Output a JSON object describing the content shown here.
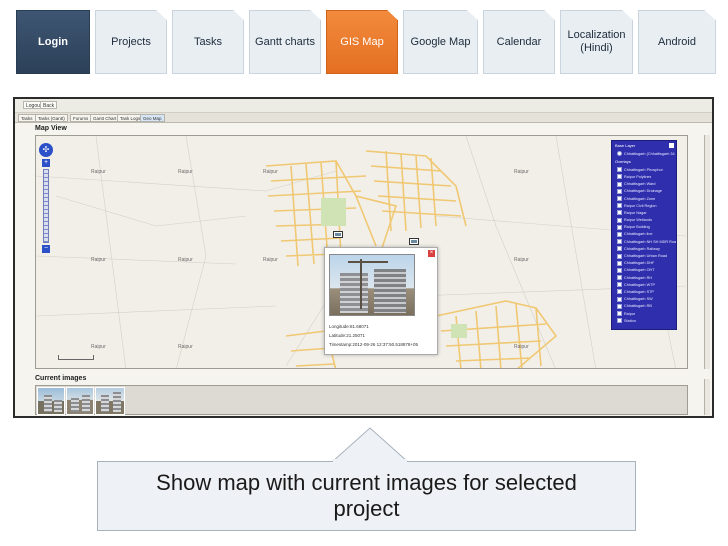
{
  "nav_tabs": [
    {
      "label": "Login",
      "state": "login"
    },
    {
      "label": "Projects",
      "state": "normal"
    },
    {
      "label": "Tasks",
      "state": "normal"
    },
    {
      "label": "Gantt charts",
      "state": "normal"
    },
    {
      "label": "GIS Map",
      "state": "active"
    },
    {
      "label": "Google Map",
      "state": "normal"
    },
    {
      "label": "Calendar",
      "state": "normal"
    },
    {
      "label": "Localization",
      "sub": "(Hindi)",
      "state": "normal"
    },
    {
      "label": "Android",
      "state": "normal"
    }
  ],
  "colors": {
    "login_bg": "#34495f",
    "active_bg": "#ec7a2e",
    "layer_panel": "#2f2fae",
    "road": "#f0c873"
  },
  "app": {
    "top_buttons": [
      "Logout",
      "Back"
    ],
    "tabs": [
      "Tasks",
      "Tasks (Gantt)",
      "Forums",
      "Gantt Chart",
      "Task Logs",
      "Geo Map"
    ],
    "map_title": "Map View",
    "images_title": "Current images",
    "place_label": "Raipur",
    "popup": {
      "longitude": "Longitude:81.68071",
      "latitude": "Latitude:21.25071",
      "timestamp": "Timestamp:2012-09-26 12:37:50.518878+05"
    },
    "layer_panel": {
      "title": "Base Layer",
      "base_option": "Chhattisgarh (Chhattisgarh 34 (Fx)",
      "overlay_heading": "Overlays",
      "layers": [
        "Chhattisgarh Phosphor",
        "Raipur Polylines",
        "Chhattisgarh Ward",
        "Chhattisgarh Drainage",
        "Chhattisgarh Zone",
        "Raipur Civil Region",
        "Raipur Nagar",
        "Raipur Wetlands",
        "Raipur Building",
        "Chhattisgarh line",
        "Chhattisgarh NH SH MDR Roads",
        "Chhattisgarh Railway",
        "Chhattisgarh Urban Road",
        "Chhattisgarh DHF",
        "Chhattisgarh OHT",
        "Chhattisgarh RH",
        "Chhattisgarh WTP",
        "Chhattisgarh STP",
        "Chhattisgarh SW",
        "Chhattisgarh RB",
        "Raipur",
        "Station"
      ]
    }
  },
  "callout": {
    "text": "Show map with current images for selected project"
  }
}
